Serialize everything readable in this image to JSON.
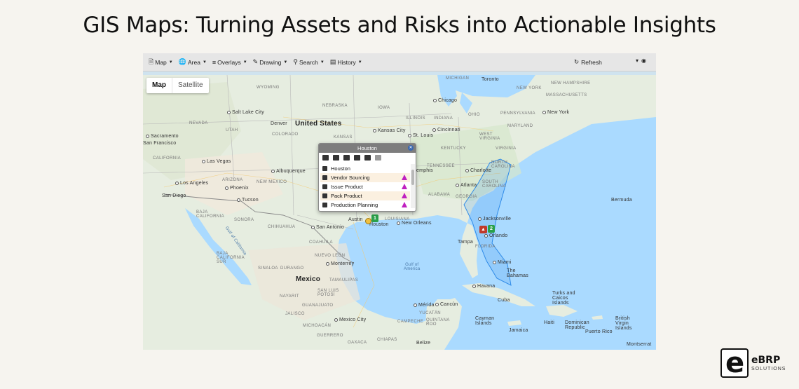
{
  "headline": "GIS Maps: Turning Assets and Risks into Actionable Insights",
  "toolbar": {
    "items": [
      {
        "label": "Map",
        "icon": "document-icon"
      },
      {
        "label": "Area",
        "icon": "globe-icon"
      },
      {
        "label": "Overlays",
        "icon": "layers-icon"
      },
      {
        "label": "Drawing",
        "icon": "pencil-icon"
      },
      {
        "label": "Search",
        "icon": "search-icon"
      },
      {
        "label": "History",
        "icon": "calendar-icon"
      }
    ],
    "refresh_label": "Refresh"
  },
  "map_type": {
    "map": "Map",
    "satellite": "Satellite"
  },
  "map_labels": {
    "michigan": "MICHIGAN",
    "toronto": "Toronto",
    "wyoming": "WYOMING",
    "new_york": "NEW YORK",
    "new_hampshire": "NEW\nHAMPSHIRE",
    "massachusetts": "MASSACHUSETTS",
    "nebraska": "NEBRASKA",
    "iowa": "IOWA",
    "chicago": "Chicago",
    "salt_lake": "Salt Lake City",
    "nevada": "NEVADA",
    "illinois": "ILLINOIS",
    "indiana": "INDIANA",
    "ohio": "OHIO",
    "pennsylvania": "PENNSYLVANIA",
    "new_york_city": "New York",
    "utah": "UTAH",
    "denver": "Denver",
    "united_states": "United States",
    "kansas": "KANSAS",
    "kansas_city": "Kansas City",
    "st_louis": "St. Louis",
    "cincinnati": "Cincinnati",
    "maryland": "MARYLAND",
    "colorado": "COLORADO",
    "sacramento": "Sacramento",
    "san_francisco": "San Francisco",
    "west_virginia": "WEST\nVIRGINIA",
    "kentucky": "KENTUCKY",
    "virginia": "VIRGINIA",
    "california": "CALIFORNIA",
    "las_vegas": "Las Vegas",
    "tennessee": "TENNESSEE",
    "memphis": "emphis",
    "charlotte": "Charlotte",
    "north_carolina": "NORTH\nCAROLINA",
    "albuquerque": "Albuquerque",
    "los_angeles": "Los Angeles",
    "arizona": "ARIZONA",
    "new_mexico": "NEW MEXICO",
    "south_carolina": "SOUTH\nCAROLINA",
    "atlanta": "Atlanta",
    "phoenix": "Phoenix",
    "alabama": "ALABAMA",
    "georgia": "GEORGIA",
    "san_diego": "San Diego",
    "tucson": "Tucson",
    "bermuda": "Bermuda",
    "baja_california": "BAJA\nCALIFORNIA",
    "jacksonville": "Jacksonville",
    "sonora": "SONORA",
    "chihuahua": "CHIHUAHUA",
    "louisiana": "LOUISIANA",
    "new_orleans": "New Orleans",
    "austin": "Austin",
    "houston": "Houston",
    "san_antonio": "San Antonio",
    "orlando": "Orlando",
    "tampa": "Tampa",
    "florida": "FLORIDA",
    "gulf_of_california": "Gulf of California",
    "coahuila": "COAHUILA",
    "baja_california_sur": "BAJA\nCALIFORNIA\nSUR",
    "nuevo_leon": "NUEVO LEÓN",
    "monterrey": "Monterrey",
    "gulf_of_mexico": "Gulf of\nAmerica",
    "miami": "Miami",
    "the_bahamas": "The\nBahamas",
    "sinaloa": "SINALOA",
    "durango": "DURANGO",
    "mexico": "Mexico",
    "tamaulipas": "TAMAULIPAS",
    "san_luis_potosi": "SAN LUIS\nPOTOSÍ",
    "havana": "Havana",
    "turks": "Turks and\nCaicos\nIslands",
    "nayarit": "NAYARIT",
    "cuba": "Cuba",
    "guanajuato": "GUANAJUATO",
    "merida": "Mérida",
    "cancun": "Cancún",
    "yucatan": "YUCATÁN",
    "jalisco": "JALISCO",
    "quintana_roo": "QUINTANA\nROO",
    "mexico_city": "Mexico City",
    "cayman": "Cayman\nIslands",
    "campeche": "CAMPECHE",
    "haiti": "Haiti",
    "dominican": "Dominican\nRepublic",
    "bvi": "British\nVirgin\nIslands",
    "michoacan": "MICHOACÁN",
    "jamaica": "Jamaica",
    "guerrero": "GUERRERO",
    "oaxaca": "OAXACA",
    "chiapas": "CHIAPAS",
    "belize": "Belize",
    "puerto_rico": "Puerto Rico",
    "montserrat": "Montserrat"
  },
  "popup": {
    "title": "Houston",
    "items": [
      {
        "label": "Houston",
        "warning": false
      },
      {
        "label": "Vendor Sourcing",
        "warning": true
      },
      {
        "label": "Issue Product",
        "warning": true
      },
      {
        "label": "Pack Product",
        "warning": true
      },
      {
        "label": "Production Planning",
        "warning": true
      }
    ]
  },
  "markers": {
    "houston_count": "1",
    "florida_count": "2"
  },
  "colors": {
    "water": "#aadaff",
    "land": "#e8eee0",
    "risk_polygon": "#2f8be8",
    "warning": "#c020c0",
    "marker_green": "#2aa04a",
    "marker_red": "#c0392b"
  },
  "brand": {
    "name": "eBRP",
    "sub": "SOLUTIONS"
  }
}
